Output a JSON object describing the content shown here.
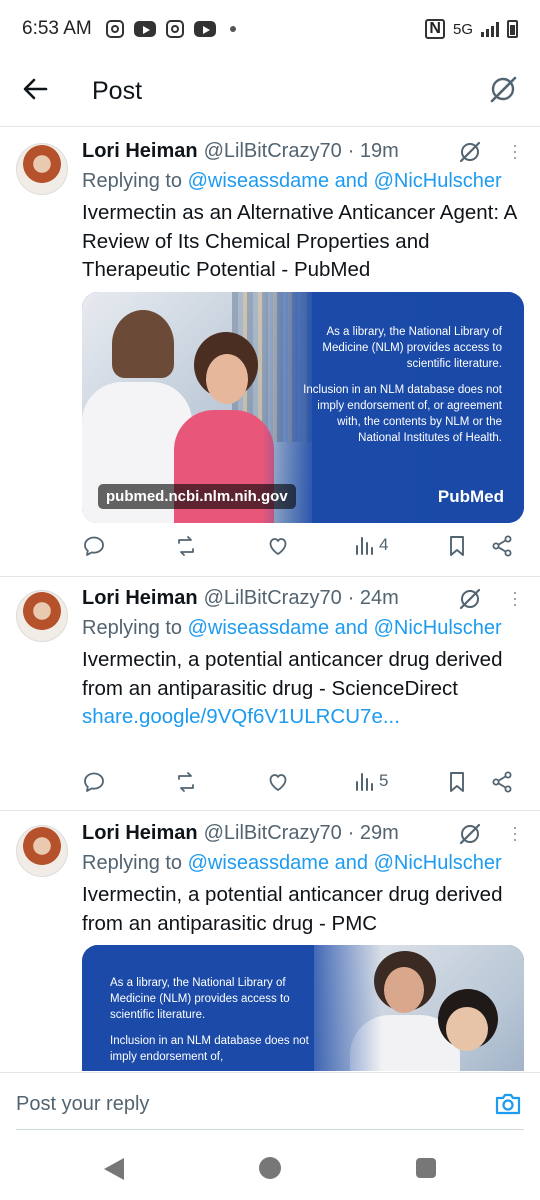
{
  "status_bar": {
    "time": "6:53 AM",
    "network": "5G",
    "icons": [
      "instagram-icon",
      "youtube-icon",
      "instagram-icon",
      "youtube-icon",
      "dot-icon",
      "nfc-icon",
      "signal-icon",
      "battery-icon"
    ]
  },
  "header": {
    "title": "Post",
    "back_icon": "arrow-left-icon",
    "grok_icon": "grok-icon"
  },
  "tweets": [
    {
      "name": "Lori Heiman",
      "handle": "@LilBitCrazy70",
      "time": "· 19m",
      "replying_prefix": "Replying to ",
      "replying_to": "@wiseassdame and @NicHulscher",
      "text": "Ivermectin as an Alternative Anticancer Agent: A Review of Its Chemical Properties and Therapeutic Potential - PubMed",
      "link": "",
      "card": {
        "p1": "As a library, the National Library of Medicine (NLM) provides access to scientific literature.",
        "p2": "Inclusion in an NLM database does not imply endorsement of, or agreement with, the contents by NLM or the National Institutes of Health.",
        "domain": "pubmed.ncbi.nlm.nih.gov",
        "logo": "PubMed"
      },
      "views": "4"
    },
    {
      "name": "Lori Heiman",
      "handle": "@LilBitCrazy70",
      "time": "· 24m",
      "replying_prefix": "Replying to ",
      "replying_to": "@wiseassdame and @NicHulscher",
      "text": "Ivermectin, a potential anticancer drug derived from an antiparasitic drug - ScienceDirect ",
      "link": "share.google/9VQf6V1ULRCU7e...",
      "views": "5"
    },
    {
      "name": "Lori Heiman",
      "handle": "@LilBitCrazy70",
      "time": "· 29m",
      "replying_prefix": "Replying to ",
      "replying_to": "@wiseassdame and @NicHulscher",
      "text": "Ivermectin, a potential anticancer drug derived from an antiparasitic drug - PMC",
      "link": "",
      "card": {
        "p1": "As a library, the National Library of Medicine (NLM) provides access to scientific literature.",
        "p2": "Inclusion in an NLM database does not imply endorsement of,"
      }
    }
  ],
  "reply_bar": {
    "placeholder": "Post your reply",
    "camera_icon": "camera-icon"
  },
  "nav_bar": [
    "back-icon",
    "home-icon",
    "recents-icon"
  ],
  "colors": {
    "link": "#1d9bf0",
    "secondary_text": "#536471",
    "card_blue": "#1b4aa8"
  }
}
